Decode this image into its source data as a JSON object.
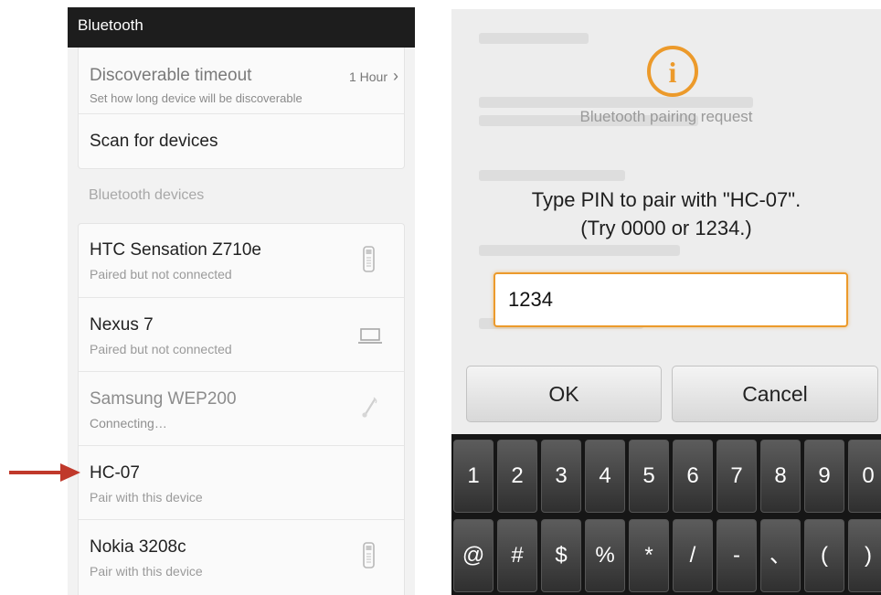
{
  "left": {
    "header_title": "Bluetooth",
    "settings": [
      {
        "title": "Discoverable timeout",
        "subtitle": "Set how long device will be discoverable",
        "value": "1 Hour",
        "chevron": "›"
      },
      {
        "title": "Scan for devices"
      }
    ],
    "section_title": "Bluetooth devices",
    "devices": [
      {
        "name": "HTC Sensation Z710e",
        "status": "Paired but not connected",
        "icon": "phone-icon"
      },
      {
        "name": "Nexus 7",
        "status": "Paired but not connected",
        "icon": "laptop-icon"
      },
      {
        "name": "Samsung WEP200",
        "status": "Connecting…",
        "icon": "headset-icon"
      },
      {
        "name": "HC-07",
        "status": "Pair with this device"
      },
      {
        "name": "Nokia 3208c",
        "status": "Pair with this device",
        "icon": "phone-icon"
      }
    ],
    "arrow_color": "#c0392b"
  },
  "dialog": {
    "icon": "info-icon",
    "icon_glyph": "i",
    "title": "Bluetooth pairing request",
    "message_line1": "Type PIN to pair with \"HC-07\".",
    "message_line2": "(Try 0000 or 1234.)",
    "pin_value": "1234",
    "ok_label": "OK",
    "cancel_label": "Cancel",
    "accent_color": "#ec9a2b"
  },
  "keyboard": {
    "row1": [
      "1",
      "2",
      "3",
      "4",
      "5",
      "6",
      "7",
      "8",
      "9",
      "0"
    ],
    "row2": [
      "@",
      "#",
      "$",
      "%",
      "*",
      "/",
      "-",
      "、",
      "(",
      ")"
    ]
  }
}
